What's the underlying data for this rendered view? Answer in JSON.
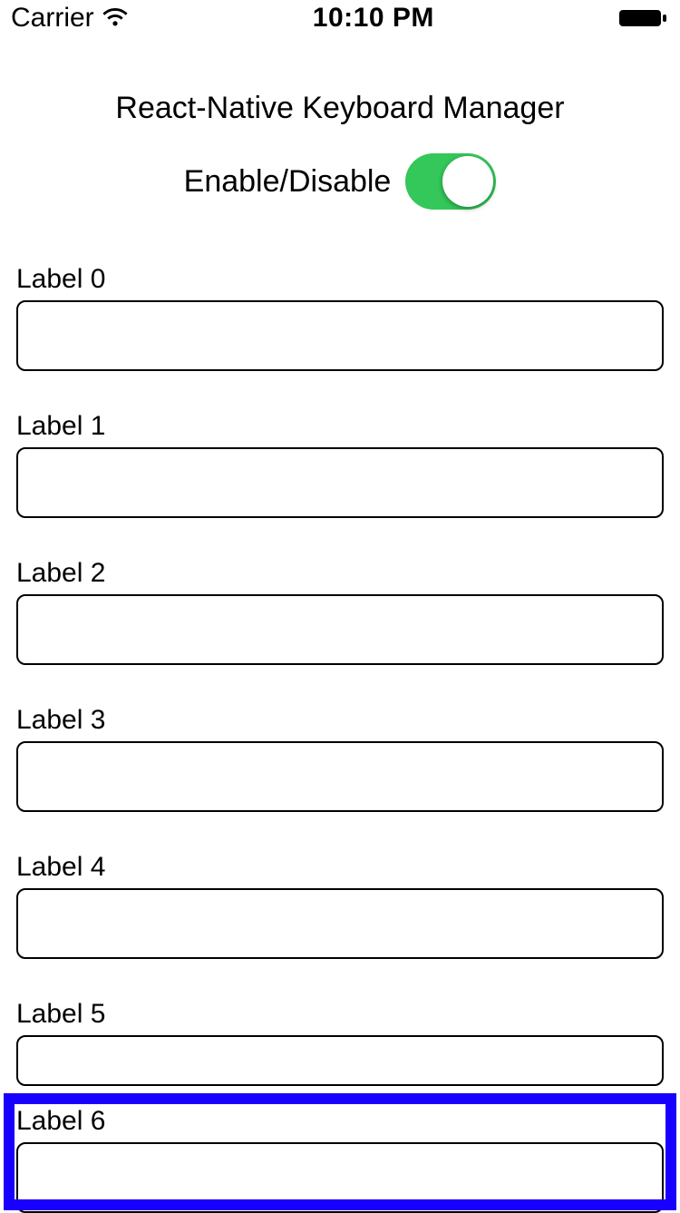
{
  "status_bar": {
    "carrier": "Carrier",
    "time": "10:10 PM"
  },
  "header": {
    "title": "React-Native Keyboard Manager",
    "toggle_label": "Enable/Disable",
    "toggle_on": true
  },
  "fields": [
    {
      "label": "Label 0",
      "value": ""
    },
    {
      "label": "Label 1",
      "value": ""
    },
    {
      "label": "Label 2",
      "value": ""
    },
    {
      "label": "Label 3",
      "value": ""
    },
    {
      "label": "Label 4",
      "value": ""
    },
    {
      "label": "Label 5",
      "value": ""
    },
    {
      "label": "Label 6",
      "value": ""
    }
  ],
  "highlight": {
    "color": "#1800FF",
    "field_index": 6
  }
}
